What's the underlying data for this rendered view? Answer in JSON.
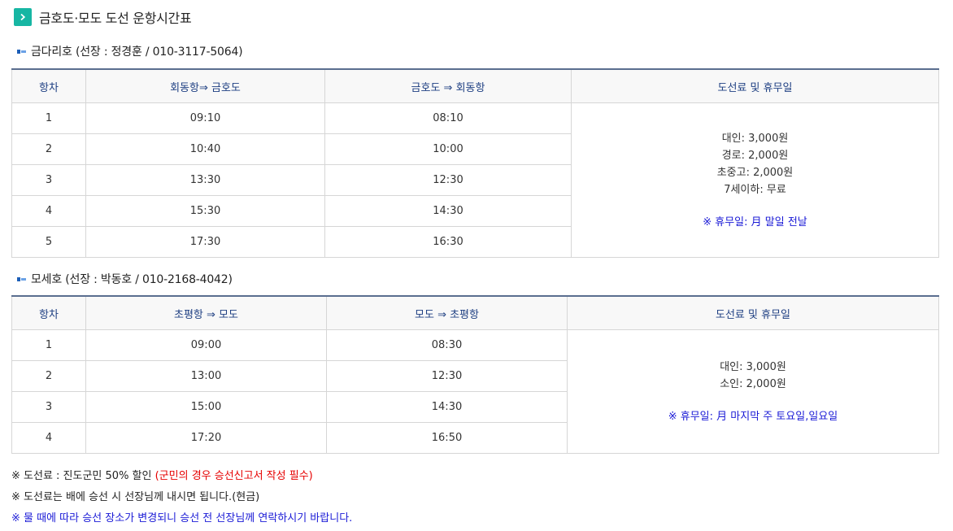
{
  "page_title": "금호도·모도 도선 운항시간표",
  "route1": {
    "heading": "금다리호 (선장 : 정경훈 / 010-3117-5064)",
    "columns": [
      "항차",
      "회동항⇒ 금호도",
      "금호도 ⇒ 회동항",
      "도선료 및 휴무일"
    ],
    "rows": [
      {
        "no": "1",
        "out": "09:10",
        "back": "08:10"
      },
      {
        "no": "2",
        "out": "10:40",
        "back": "10:00"
      },
      {
        "no": "3",
        "out": "13:30",
        "back": "12:30"
      },
      {
        "no": "4",
        "out": "15:30",
        "back": "14:30"
      },
      {
        "no": "5",
        "out": "17:30",
        "back": "16:30"
      }
    ],
    "fares": [
      "대인: 3,000원",
      "경로: 2,000원",
      "초중고: 2,000원",
      "7세이하: 무료"
    ],
    "rest_day": "※ 휴무일: 月 말일 전날"
  },
  "route2": {
    "heading": "모세호 (선장 : 박동호 / 010-2168-4042)",
    "columns": [
      "항차",
      "초평항 ⇒ 모도",
      "모도 ⇒ 초평항",
      "도선료 및 휴무일"
    ],
    "rows": [
      {
        "no": "1",
        "out": "09:00",
        "back": "08:30"
      },
      {
        "no": "2",
        "out": "13:00",
        "back": "12:30"
      },
      {
        "no": "3",
        "out": "15:00",
        "back": "14:30"
      },
      {
        "no": "4",
        "out": "17:20",
        "back": "16:50"
      }
    ],
    "fares": [
      "대인: 3,000원",
      "소인: 2,000원"
    ],
    "rest_day": "※ 휴무일: 月 마지막 주 토요일,일요일"
  },
  "notes": {
    "line1_prefix": "※ 도선료 : 진도군민 50% 할인 ",
    "line1_red": "(군민의 경우 승선신고서 작성 필수)",
    "line2": "※ 도선료는 배에 승선 시 선장님께 내시면 됩니다.(현금)",
    "line3": "※ 물 때에 따라 승선 장소가 변경되니 승선 전 선장님께 연락하시기 바랍니다."
  },
  "colors": {
    "accent": "#17b6a3",
    "header_text": "#1e3f82",
    "notice_blue": "#1a1ad6",
    "notice_red": "#e60000"
  }
}
